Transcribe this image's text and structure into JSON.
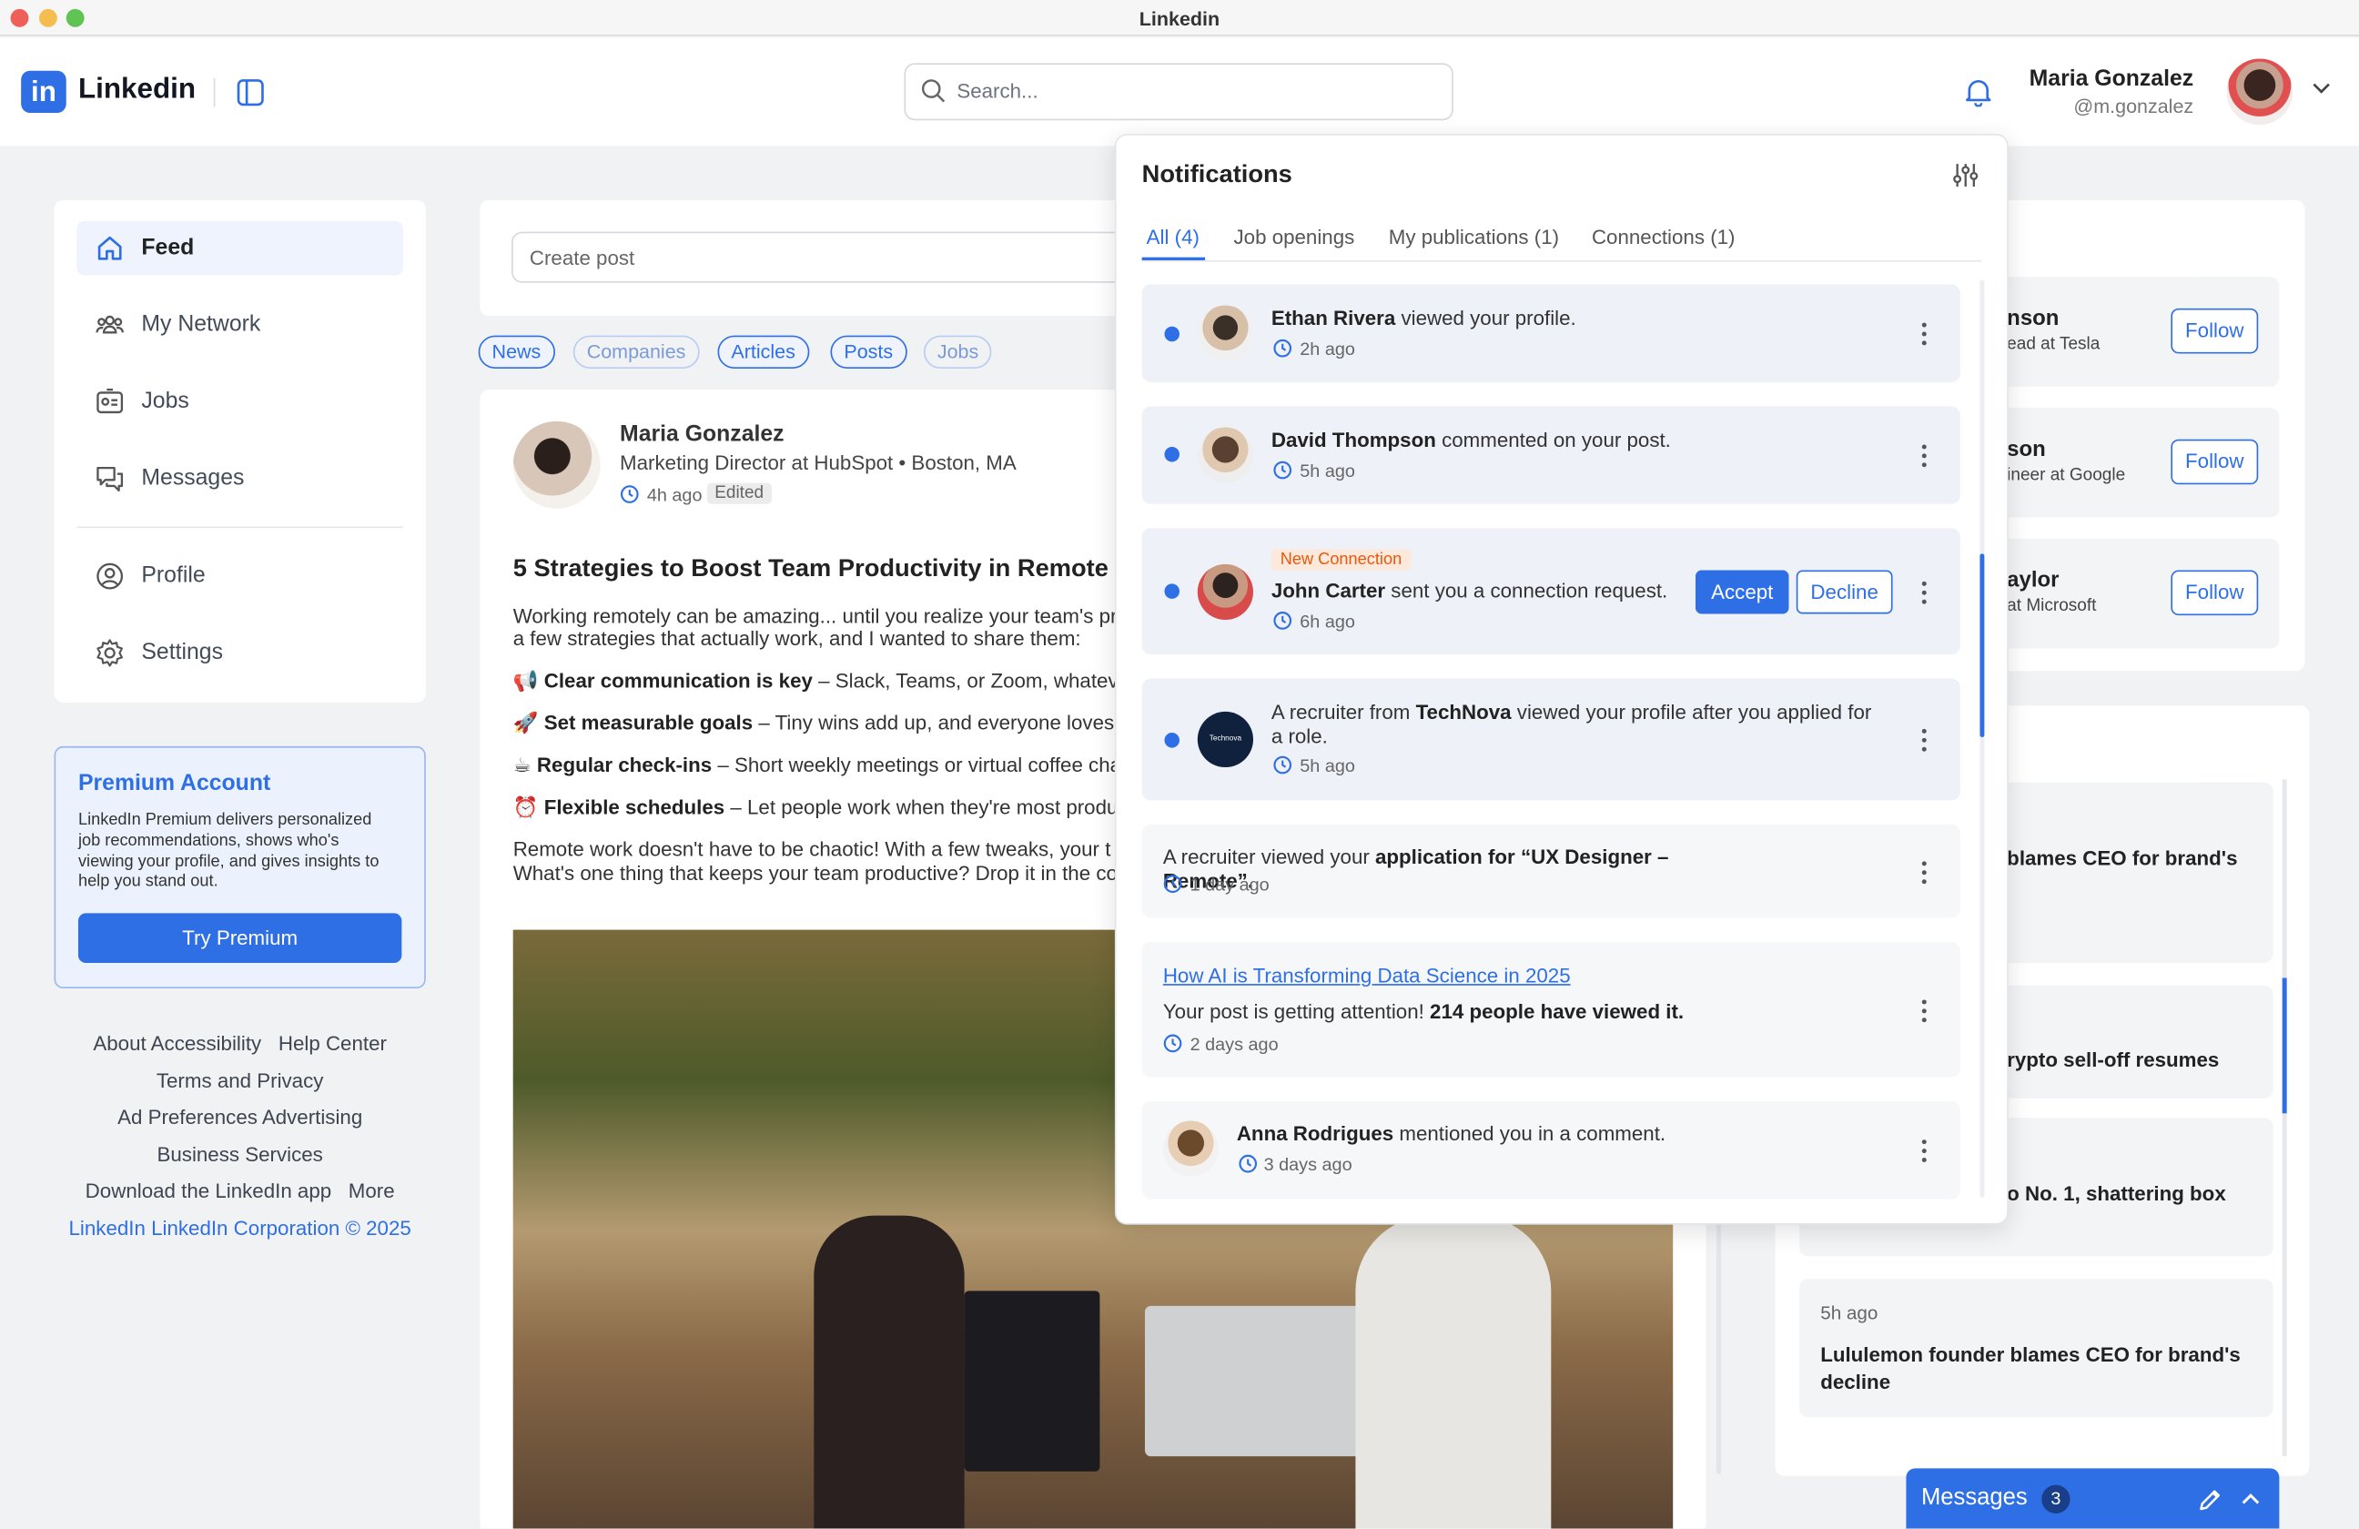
{
  "window": {
    "title": "Linkedin"
  },
  "header": {
    "brand": "Linkedin",
    "logo_text": "in",
    "search_placeholder": "Search...",
    "user_name": "Maria Gonzalez",
    "user_handle": "@m.gonzalez"
  },
  "sidebar": {
    "items": [
      {
        "label": "Feed",
        "icon": "home-icon"
      },
      {
        "label": "My Network",
        "icon": "people-icon"
      },
      {
        "label": "Jobs",
        "icon": "id-card-icon"
      },
      {
        "label": "Messages",
        "icon": "chat-icon"
      },
      {
        "label": "Profile",
        "icon": "user-circle-icon"
      },
      {
        "label": "Settings",
        "icon": "gear-icon"
      }
    ]
  },
  "premium": {
    "title": "Premium Account",
    "lines": [
      "LinkedIn Premium delivers personalized",
      "job recommendations, shows who's",
      "viewing your profile, and gives insights to",
      "help you stand out."
    ],
    "button": "Try Premium"
  },
  "footer": {
    "row1": [
      "About Accessibility",
      "Help Center"
    ],
    "row2": "Terms and Privacy",
    "row3": "Ad Preferences Advertising",
    "row4": "Business Services",
    "row5": [
      "Download the LinkedIn app",
      "More"
    ],
    "copyright": "LinkedIn LinkedIn Corporation © 2025"
  },
  "feed": {
    "create_post": "Create post",
    "filters": [
      "News",
      "Companies",
      "Articles",
      "Posts",
      "Jobs"
    ],
    "post": {
      "author": "Maria Gonzalez",
      "role": "Marketing Director at HubSpot • Boston, MA",
      "time": "4h ago",
      "edited": "Edited",
      "title": "5 Strategies to Boost Team Productivity in Remote",
      "intro1": "Working remotely can be amazing... until you realize your team's pr",
      "intro2": "a few strategies that actually work, and I wanted to share them:",
      "points": [
        {
          "emoji": "📢",
          "bold": "Clear communication is key",
          "rest": " – Slack, Teams, or Zoom, whatever"
        },
        {
          "emoji": "🚀",
          "bold": "Set measurable goals",
          "rest": " – Tiny wins add up, and everyone loves se"
        },
        {
          "emoji": "☕",
          "bold": "Regular check-ins",
          "rest": " – Short weekly meetings or virtual coffee cha"
        },
        {
          "emoji": "⏰",
          "bold": "Flexible schedules",
          "rest": " – Let people work when they're most produc"
        }
      ],
      "outro1": "Remote work doesn't have to be chaotic! With a few tweaks, your t",
      "outro2": "What's one thing that keeps your team productive? Drop it in the co"
    }
  },
  "suggestions": [
    {
      "name": "nson",
      "sub": "ead at Tesla",
      "button": "Follow"
    },
    {
      "name": "son",
      "sub": "ineer at Google",
      "button": "Follow"
    },
    {
      "name": "aylor",
      "sub": "at Microsoft",
      "button": "Follow"
    }
  ],
  "news": [
    {
      "title": "blames CEO for brand's"
    },
    {
      "title": "rypto sell-off resumes"
    },
    {
      "title": "o No. 1, shattering box"
    },
    {
      "time": "5h ago",
      "title1": "Lululemon founder blames CEO for brand's",
      "title2": "decline"
    }
  ],
  "messages_bar": {
    "label": "Messages",
    "count": "3"
  },
  "notifications": {
    "title": "Notifications",
    "tabs": [
      "All (4)",
      "Job openings",
      "My publications (1)",
      "Connections (1)"
    ],
    "items": [
      {
        "name": "Ethan Rivera",
        "text": " viewed your profile.",
        "time": "2h ago"
      },
      {
        "name": "David Thompson",
        "text": " commented on your post.",
        "time": "5h ago"
      },
      {
        "tag": "New Connection",
        "name": "John Carter",
        "text": " sent you a connection request.",
        "time": "6h ago",
        "accept": "Accept",
        "decline": "Decline"
      },
      {
        "pre": "A recruiter from ",
        "name": "TechNova",
        "text": " viewed your profile after you applied for",
        "text2": "a role.",
        "time": "5h ago",
        "logo": "Technova"
      },
      {
        "pre": "A recruiter viewed your ",
        "bold": "application for “UX Designer –",
        "line2": "Remote”.",
        "time": "1 day ago"
      },
      {
        "link": "How AI is Transforming Data Science in 2025",
        "pre": "Your post is getting attention! ",
        "bold": "214 people have viewed it.",
        "time": "2 days ago"
      },
      {
        "name": "Anna Rodrigues",
        "text": " mentioned you in a comment.",
        "time": "3 days ago"
      }
    ]
  },
  "colors": {
    "accent": "#2f6fe5",
    "unread_bg": "#eef1f7",
    "tag": "#e8590c"
  }
}
